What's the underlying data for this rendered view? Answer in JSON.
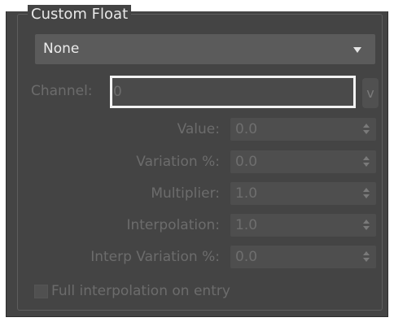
{
  "rollout": {
    "title": "Custom Float"
  },
  "source_dropdown": {
    "selected": "None"
  },
  "channel": {
    "label": "Channel:",
    "value": "0",
    "button_label": "v"
  },
  "fields": [
    {
      "label": "Value:",
      "value": "0.0"
    },
    {
      "label": "Variation %:",
      "value": "0.0"
    },
    {
      "label": "Multiplier:",
      "value": "1.0"
    },
    {
      "label": "Interpolation:",
      "value": "1.0"
    },
    {
      "label": "Interp Variation %:",
      "value": "0.0"
    }
  ],
  "full_interpolation": {
    "label": "Full interpolation on entry",
    "checked": false
  },
  "colors": {
    "panel_bg": "#444444",
    "dropdown_bg": "#5b5b5b",
    "disabled_text": "#6c6c6c",
    "focus_border": "#f2f2f2"
  }
}
